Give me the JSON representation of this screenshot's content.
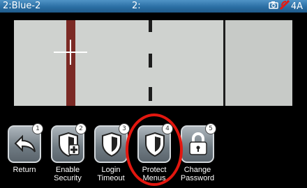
{
  "status_bar": {
    "channel": "2:Blue-2",
    "preset": "2:",
    "amperage": "4A",
    "icons": [
      "camera-icon",
      "wireless-signal-icon"
    ]
  },
  "video_feed": {
    "crosshair_icon": "crosshair-icon"
  },
  "security_menu": {
    "buttons": [
      {
        "number": "1",
        "label_line1": "Return",
        "label_line2": "",
        "icon": "return-arrow-icon"
      },
      {
        "number": "2",
        "label_line1": "Enable",
        "label_line2": "Security",
        "icon": "shield-add-icon"
      },
      {
        "number": "3",
        "label_line1": "Login",
        "label_line2": "Timeout",
        "icon": "shield-icon"
      },
      {
        "number": "4",
        "label_line1": "Protect",
        "label_line2": "Menus",
        "icon": "shield-icon"
      },
      {
        "number": "5",
        "label_line1": "Change",
        "label_line2": "Password",
        "icon": "padlock-icon"
      }
    ]
  },
  "colors": {
    "status_bar": "#2b6fa4",
    "highlight": "#e3170f"
  }
}
